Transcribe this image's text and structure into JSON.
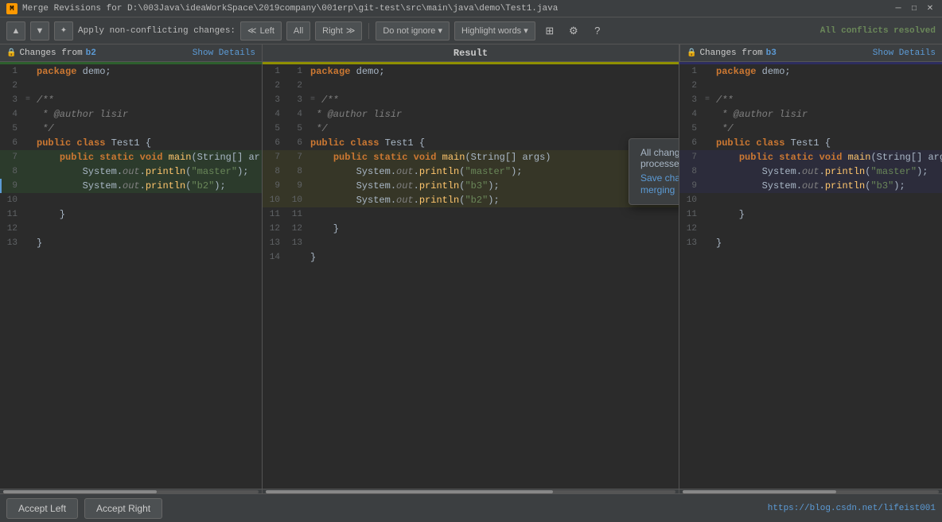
{
  "titleBar": {
    "title": "Merge Revisions for D:\\003Java\\ideaWorkSpace\\2019company\\001erp\\git-test\\src\\main\\java\\demo\\Test1.java",
    "closeBtn": "✕"
  },
  "toolbar": {
    "prevBtn": "▲",
    "nextBtn": "▼",
    "applyLabel": "Apply non-conflicting changes:",
    "leftBtn": "◀ Left",
    "allBtn": "All",
    "rightBtn": "Right ▶",
    "ignoreBtn": "Do not ignore ▾",
    "highlightBtn": "Highlight words ▾",
    "columnsIcon": "⊞",
    "settingsIcon": "⚙",
    "helpIcon": "?",
    "resolvedText": "All conflicts resolved"
  },
  "leftPanel": {
    "lockIcon": "🔒",
    "label": "Changes from",
    "branch": "b2",
    "showDetails": "Show Details"
  },
  "centerPanel": {
    "label": "Result"
  },
  "rightPanel": {
    "lockIcon": "🔒",
    "label": "Changes from",
    "branch": "b3",
    "showDetails": "Show Details"
  },
  "tooltip": {
    "title": "All changes have been processed.",
    "link": "Save changes and finish merging"
  },
  "bottomBar": {
    "acceptLeftBtn": "Accept Left",
    "acceptRightBtn": "Accept Right",
    "statusLink": "https://blog.csdn.net/lifeist001"
  },
  "code": {
    "leftLines": [
      {
        "num": 1,
        "content": "package demo;"
      },
      {
        "num": 2,
        "content": ""
      },
      {
        "num": 3,
        "content": "/**"
      },
      {
        "num": 4,
        "content": " * @author lisir"
      },
      {
        "num": 5,
        "content": " */"
      },
      {
        "num": 6,
        "content": "public class Test1 {"
      },
      {
        "num": 7,
        "content": "    public static void main(String[] ar"
      },
      {
        "num": 8,
        "content": "        System.out.println(\"master\");"
      },
      {
        "num": 9,
        "content": "        System.out.println(\"b2\");"
      },
      {
        "num": 10,
        "content": ""
      },
      {
        "num": 11,
        "content": "    }"
      },
      {
        "num": 12,
        "content": ""
      },
      {
        "num": 13,
        "content": "}"
      }
    ],
    "centerLines": [
      {
        "num": 1,
        "content": "package demo;"
      },
      {
        "num": 2,
        "content": ""
      },
      {
        "num": 3,
        "content": "/**"
      },
      {
        "num": 4,
        "content": " * @author lisir"
      },
      {
        "num": 5,
        "content": " */"
      },
      {
        "num": 6,
        "content": "public class Test1 {"
      },
      {
        "num": 7,
        "content": "    public static void main(String[] args)"
      },
      {
        "num": 8,
        "content": "        System.out.println(\"master\");"
      },
      {
        "num": 9,
        "content": "        System.out.println(\"b3\");"
      },
      {
        "num": 10,
        "content": "        System.out.println(\"b2\");"
      },
      {
        "num": 11,
        "content": ""
      },
      {
        "num": 12,
        "content": "    }"
      },
      {
        "num": 13,
        "content": ""
      },
      {
        "num": 14,
        "content": "}"
      }
    ],
    "rightLines": [
      {
        "num": 1,
        "content": "package demo;"
      },
      {
        "num": 2,
        "content": ""
      },
      {
        "num": 3,
        "content": "/**"
      },
      {
        "num": 4,
        "content": " * @author lisir"
      },
      {
        "num": 5,
        "content": " */"
      },
      {
        "num": 6,
        "content": "public class Test1 {"
      },
      {
        "num": 7,
        "content": "    public static void main(String[] args"
      },
      {
        "num": 8,
        "content": "        System.out.println(\"master\");"
      },
      {
        "num": 9,
        "content": "        System.out.println(\"b3\");"
      },
      {
        "num": 10,
        "content": ""
      },
      {
        "num": 11,
        "content": "    }"
      },
      {
        "num": 12,
        "content": ""
      },
      {
        "num": 13,
        "content": "}"
      }
    ]
  }
}
